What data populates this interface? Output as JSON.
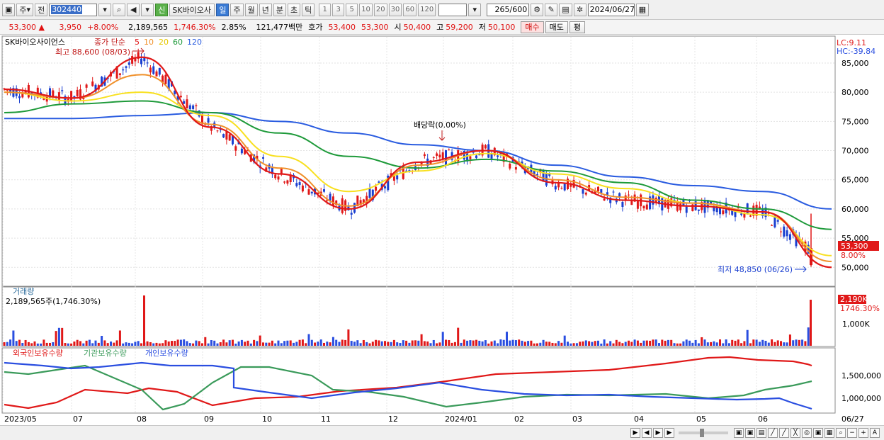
{
  "toolbar": {
    "period": "주",
    "prefix": "전",
    "code": "302440",
    "badge": "신",
    "stock_name": "SK바이오사",
    "tabs": [
      "일",
      "주",
      "월",
      "년",
      "분",
      "초",
      "틱"
    ],
    "active_tab": "일",
    "numbers": [
      "1",
      "3",
      "5",
      "10",
      "20",
      "30",
      "60",
      "120"
    ],
    "count": "265",
    "count_total": "/600",
    "date": "2024/06/27"
  },
  "price": {
    "current": "53,300",
    "change": "3,950",
    "change_pct": "+8.00%",
    "volume": "2,189,565",
    "volume_pct": "1,746.30%",
    "turnover_rate": "2.85%",
    "amount": "121,477백만",
    "ask_label": "호가",
    "ask": "53,400",
    "bid": "53,300",
    "open_label": "시",
    "open": "50,400",
    "high_label": "고",
    "high": "59,200",
    "low_label": "저",
    "low": "50,100",
    "buy_label": "매수",
    "sell_label": "매도",
    "eval_label": "평"
  },
  "chart": {
    "title": "SK바이오사이언스",
    "ma_label": "종가 단순",
    "ma_periods": [
      "5",
      "10",
      "20",
      "60",
      "120"
    ],
    "high_note": "최고 88,600 (08/03)",
    "low_note": "최저 48,850 (06/26)",
    "dividend_note": "배당락(0.00%)",
    "lc": "LC:9.11",
    "hc": "HC:-39.84",
    "price_tag": "53,300",
    "price_tag_pct": "8.00%",
    "y_ticks": [
      "85,000",
      "80,000",
      "75,000",
      "70,000",
      "65,000",
      "60,000",
      "55,000",
      "50,000"
    ],
    "vol_title": "거래량",
    "vol_value": "2,189,565주(1,746.30%)",
    "vol_tag": "2,190K",
    "vol_tag_pct": "1746.30%",
    "vol_tick": "1,000K",
    "hold_labels": [
      "외국인보유수량",
      "기관보유수량",
      "개인보유수량"
    ],
    "hold_ticks": [
      "1,500,000",
      "1,000,000"
    ],
    "x_ticks": [
      "2023/05",
      "07",
      "08",
      "09",
      "10",
      "11",
      "12",
      "2024/01",
      "02",
      "03",
      "04",
      "05",
      "06"
    ],
    "x_last": "06/27",
    "colors": {
      "ma5": "#e01818",
      "ma10": "#f0902a",
      "ma20": "#f8e020",
      "ma60": "#1e9a3a",
      "ma120": "#2a5ce0",
      "foreign": "#e01818",
      "institution": "#3a9a5a",
      "individual": "#2a4ee0"
    }
  },
  "chart_data": {
    "type": "line",
    "x": [
      "2023/05",
      "07",
      "08",
      "09",
      "10",
      "11",
      "12",
      "2024/01",
      "02",
      "03",
      "04",
      "05",
      "06"
    ],
    "ylim": [
      47000,
      89000
    ],
    "series": [
      {
        "name": "5",
        "values": [
          80500,
          79000,
          86000,
          74000,
          66000,
          60000,
          68000,
          70000,
          64500,
          61500,
          60500,
          59500,
          50000
        ]
      },
      {
        "name": "10",
        "values": [
          80000,
          79000,
          83000,
          74500,
          67000,
          60500,
          67500,
          70000,
          65000,
          62000,
          61000,
          59500,
          51000
        ]
      },
      {
        "name": "20",
        "values": [
          80000,
          78500,
          80000,
          76000,
          69000,
          63000,
          66500,
          69500,
          66000,
          63500,
          61000,
          59000,
          52000
        ]
      },
      {
        "name": "60",
        "values": [
          76500,
          78000,
          78500,
          76500,
          73000,
          69000,
          67000,
          68500,
          66500,
          64500,
          61500,
          60000,
          56500
        ]
      },
      {
        "name": "120",
        "values": [
          75500,
          75500,
          76000,
          76500,
          75000,
          73000,
          71000,
          70000,
          67500,
          65500,
          64000,
          63000,
          60000
        ]
      }
    ]
  }
}
